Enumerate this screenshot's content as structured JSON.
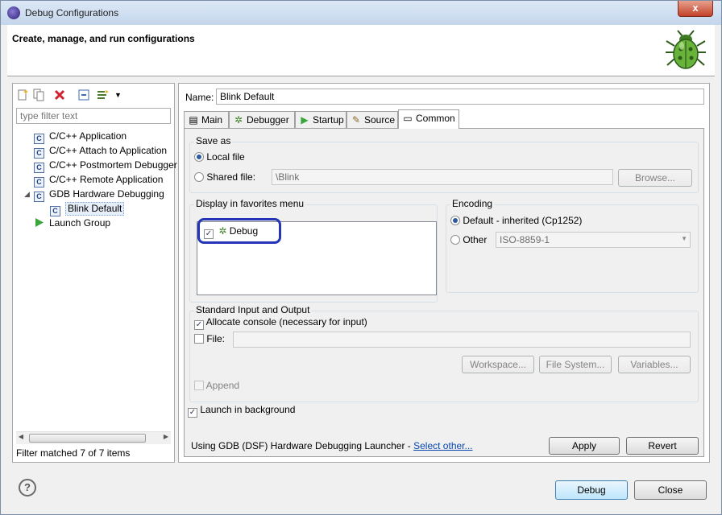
{
  "window": {
    "title": "Debug Configurations",
    "close_glyph": "x"
  },
  "banner": {
    "heading": "Create, manage, and run configurations"
  },
  "left": {
    "filter_placeholder": "type filter text",
    "tree": [
      {
        "label": "C/C++ Application",
        "icon": "c-config-icon"
      },
      {
        "label": "C/C++ Attach to Application",
        "icon": "c-config-icon"
      },
      {
        "label": "C/C++ Postmortem Debugger",
        "icon": "c-config-icon"
      },
      {
        "label": "C/C++ Remote Application",
        "icon": "c-config-icon"
      },
      {
        "label": "GDB Hardware Debugging",
        "icon": "c-config-icon",
        "expanded": true
      },
      {
        "label": "Blink Default",
        "icon": "c-config-icon",
        "selected": true
      },
      {
        "label": "Launch Group",
        "icon": "launch-group-icon"
      }
    ],
    "filter_status": "Filter matched 7 of 7 items"
  },
  "right": {
    "name_label": "Name:",
    "name_value": "Blink Default",
    "tabs": [
      {
        "label": "Main",
        "icon": "main-tab-icon"
      },
      {
        "label": "Debugger",
        "icon": "debugger-tab-icon"
      },
      {
        "label": "Startup",
        "icon": "startup-tab-icon"
      },
      {
        "label": "Source",
        "icon": "source-tab-icon"
      },
      {
        "label": "Common",
        "icon": "common-tab-icon",
        "active": true
      }
    ],
    "save_as": {
      "title": "Save as",
      "local_file": "Local file",
      "shared_file": "Shared file:",
      "shared_path": "\\Blink",
      "browse": "Browse..."
    },
    "favorites": {
      "title": "Display in favorites menu",
      "item": "Debug"
    },
    "encoding": {
      "title": "Encoding",
      "default_label": "Default - inherited (Cp1252)",
      "other_label": "Other",
      "other_value": "ISO-8859-1"
    },
    "stdio": {
      "title": "Standard Input and Output",
      "allocate_console": "Allocate console (necessary for input)",
      "file_label": "File:",
      "workspace": "Workspace...",
      "file_system": "File System...",
      "variables": "Variables...",
      "append": "Append"
    },
    "launch_background": "Launch in background",
    "launcher_prefix": "Using GDB (DSF) Hardware Debugging Launcher - ",
    "select_other": "Select other...",
    "apply": "Apply",
    "revert": "Revert"
  },
  "footer": {
    "help_glyph": "?",
    "debug": "Debug",
    "close": "Close"
  },
  "colors": {
    "highlight": "#2436b5",
    "link": "#0645ad"
  }
}
